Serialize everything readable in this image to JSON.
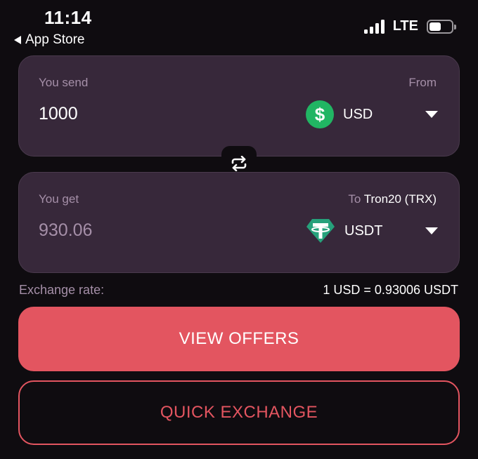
{
  "status_bar": {
    "time": "11:14",
    "back_label": "App Store",
    "network": "LTE",
    "battery_level": 0.55
  },
  "send": {
    "label": "You send",
    "right_label": "From",
    "amount": "1000",
    "currency": "USD",
    "currency_icon": "dollar-coin-icon",
    "currency_icon_color": "#21b563"
  },
  "get": {
    "label": "You get",
    "right_label_prefix": "To",
    "network": "Tron20 (TRX)",
    "amount": "930.06",
    "currency": "USDT",
    "currency_icon": "tether-icon",
    "currency_icon_color": "#26a17b"
  },
  "swap_icon": "swap-arrows-icon",
  "exchange_rate": {
    "label": "Exchange rate:",
    "value": "1 USD = 0.93006 USDT"
  },
  "buttons": {
    "view_offers": "VIEW OFFERS",
    "quick_exchange": "QUICK EXCHANGE"
  },
  "colors": {
    "background": "#0f0c10",
    "card": "#37283a",
    "accent": "#e35560",
    "muted_text": "#a58fa8"
  }
}
